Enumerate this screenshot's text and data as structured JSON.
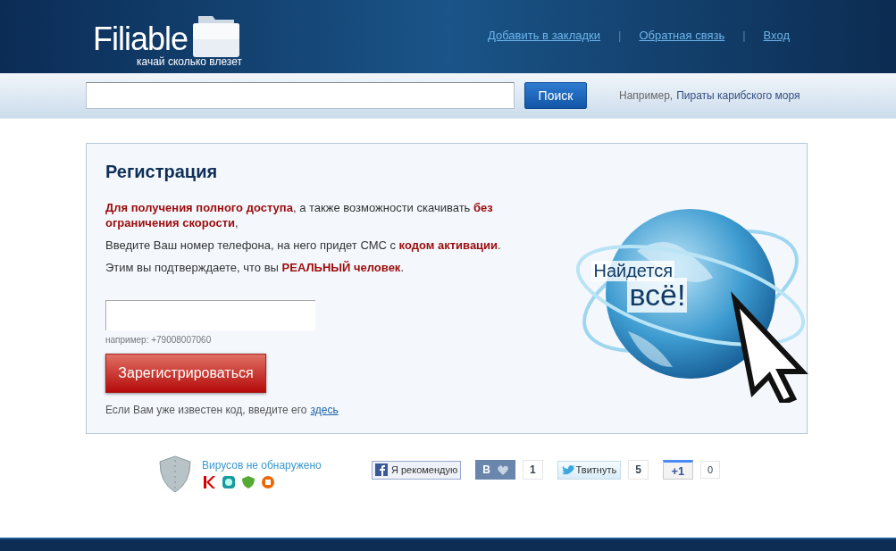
{
  "header": {
    "logo": "Filiable",
    "tagline": "качай сколько влезет",
    "links": [
      "Добавить в закладки",
      "Обратная связь",
      "Вход"
    ],
    "separator": "|"
  },
  "search": {
    "button": "Поиск",
    "example_label": "Например,",
    "example_link": "Пираты карибского моря"
  },
  "registration": {
    "title": "Регистрация",
    "paragraphs": [
      "**Для получения полного доступа**, а также возможности скачивать **без ограничения скорости**,",
      "Введите Ваш номер телефона, на него придет СМС с **кодом активации**.",
      "Этим вы подтверждаете, что вы **РЕАЛЬНЫЙ человек**."
    ],
    "phone_hint": "например: +79008007060",
    "register_button": "Зарегистрироваться",
    "code_prompt": "Если Вам уже известен код, введите его",
    "code_link": "здесь"
  },
  "promo": {
    "line_1": "Найдется",
    "line_2": "всё!"
  },
  "footer": {
    "antivirus": "Вирусов не обнаружено",
    "social": [
      {
        "kind": "facebook",
        "label": "Я рекомендую"
      },
      {
        "kind": "vk",
        "label": "В",
        "count": "1"
      },
      {
        "kind": "twitter",
        "label": "Твитнуть",
        "count": "5"
      },
      {
        "kind": "google",
        "label": "+1",
        "count": "0"
      }
    ]
  }
}
